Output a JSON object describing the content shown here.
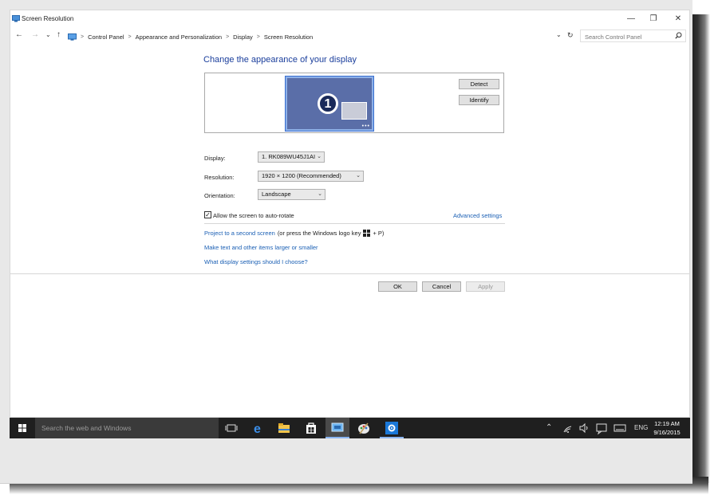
{
  "window": {
    "title": "Screen Resolution",
    "controls": {
      "minimize": "—",
      "maximize": "❐",
      "close": "✕"
    }
  },
  "addressbar": {
    "back": "←",
    "forward": "→",
    "recent": "⌄",
    "up": "↑",
    "breadcrumbs": [
      "Control Panel",
      "Appearance and Personalization",
      "Display",
      "Screen Resolution"
    ],
    "separator": ">",
    "dropdown": "⌄",
    "refresh": "↻",
    "search_placeholder": "Search Control Panel"
  },
  "main": {
    "heading": "Change the appearance of your display",
    "monitor_number": "1",
    "detect_label": "Detect",
    "identify_label": "Identify",
    "display": {
      "label": "Display:",
      "value": "1. RK089WU45J1AI"
    },
    "resolution": {
      "label": "Resolution:",
      "value": "1920 × 1200 (Recommended)"
    },
    "orientation": {
      "label": "Orientation:",
      "value": "Landscape"
    },
    "auto_rotate": {
      "label": "Allow the screen to auto-rotate",
      "checked": true
    },
    "advanced_settings": "Advanced settings",
    "project_link": "Project to a second screen",
    "project_suffix": "(or press the Windows logo key",
    "project_suffix_end": "+ P)",
    "text_size_link": "Make text and other items larger or smaller",
    "help_link": "What display settings should I choose?"
  },
  "footer": {
    "ok": "OK",
    "cancel": "Cancel",
    "apply": "Apply"
  },
  "taskbar": {
    "search_text": "Search the web and Windows",
    "language": "ENG",
    "time": "12:19 AM",
    "date": "9/16/2015"
  },
  "colors": {
    "heading": "#1a3e9c",
    "link": "#1a5fb4",
    "taskbar": "#1f1f1f",
    "monitor": "#5a6ea8"
  }
}
